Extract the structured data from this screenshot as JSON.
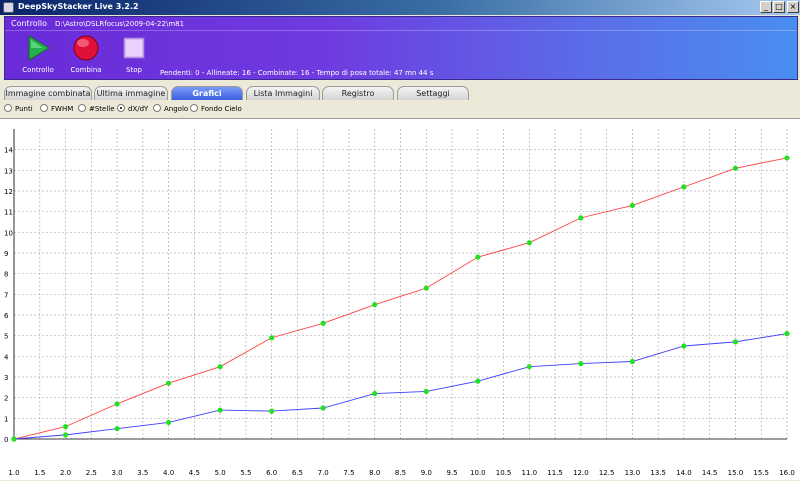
{
  "window": {
    "title": "DeepSkyStacker Live 3.2.2",
    "minimize_glyph": "_",
    "maximize_glyph": "□",
    "close_glyph": "×"
  },
  "control": {
    "title": "Controllo",
    "path": "D:\\Astro\\DSLRfocus\\2009-04-22\\m81",
    "tools": [
      {
        "label": "Controllo",
        "icon": "play-icon",
        "color": "#22b14c"
      },
      {
        "label": "Combina",
        "icon": "record-icon",
        "color": "#e0103a"
      },
      {
        "label": "Stop",
        "icon": "stop-icon",
        "color": "#d8b8f0"
      }
    ],
    "status": "Pendenti: 0 - Allineate: 16 - Combinate: 16 - Tempo di posa totale: 47 mn 44 s"
  },
  "tabs": [
    {
      "label": "Immagine combinata",
      "active": false
    },
    {
      "label": "Ultima immagine",
      "active": false
    },
    {
      "label": "Grafici",
      "active": true
    },
    {
      "label": "Lista Immagini",
      "active": false
    },
    {
      "label": "Registro",
      "active": false
    },
    {
      "label": "Settaggi",
      "active": false
    }
  ],
  "radios": [
    {
      "label": "Punti",
      "selected": false
    },
    {
      "label": "FWHM",
      "selected": false
    },
    {
      "label": "#Stelle",
      "selected": false
    },
    {
      "label": "dX/dY",
      "selected": true
    },
    {
      "label": "Angolo",
      "selected": false
    },
    {
      "label": "Fondo Cielo",
      "selected": false
    }
  ],
  "chart_data": {
    "type": "line",
    "xlim": [
      1.0,
      16.0
    ],
    "ylim": [
      0,
      15
    ],
    "x_ticks": [
      "1.0",
      "1.5",
      "2.0",
      "2.5",
      "3.0",
      "3.5",
      "4.0",
      "4.5",
      "5.0",
      "5.5",
      "6.0",
      "6.5",
      "7.0",
      "7.5",
      "8.0",
      "8.5",
      "9.0",
      "9.5",
      "10.0",
      "10.5",
      "11.0",
      "11.5",
      "12.0",
      "12.5",
      "13.0",
      "13.5",
      "14.0",
      "14.5",
      "15.0",
      "15.5",
      "16.0"
    ],
    "y_ticks": [
      "0",
      "1",
      "2",
      "3",
      "4",
      "5",
      "6",
      "7",
      "8",
      "9",
      "10",
      "11",
      "12",
      "13",
      "14"
    ],
    "grid": true,
    "marker_color": "#22e022",
    "x": [
      1,
      2,
      3,
      4,
      5,
      6,
      7,
      8,
      9,
      10,
      11,
      12,
      13,
      14,
      15,
      16
    ],
    "series": [
      {
        "color": "#ff4040",
        "values": [
          0.0,
          0.6,
          1.7,
          2.7,
          3.5,
          4.9,
          5.6,
          6.5,
          7.3,
          8.8,
          9.5,
          10.7,
          11.3,
          12.2,
          13.1,
          13.6
        ]
      },
      {
        "color": "#4040ff",
        "values": [
          0.0,
          0.2,
          0.5,
          0.8,
          1.4,
          1.35,
          1.5,
          2.2,
          2.3,
          2.8,
          3.5,
          3.65,
          3.75,
          4.5,
          4.7,
          5.1
        ]
      }
    ]
  }
}
